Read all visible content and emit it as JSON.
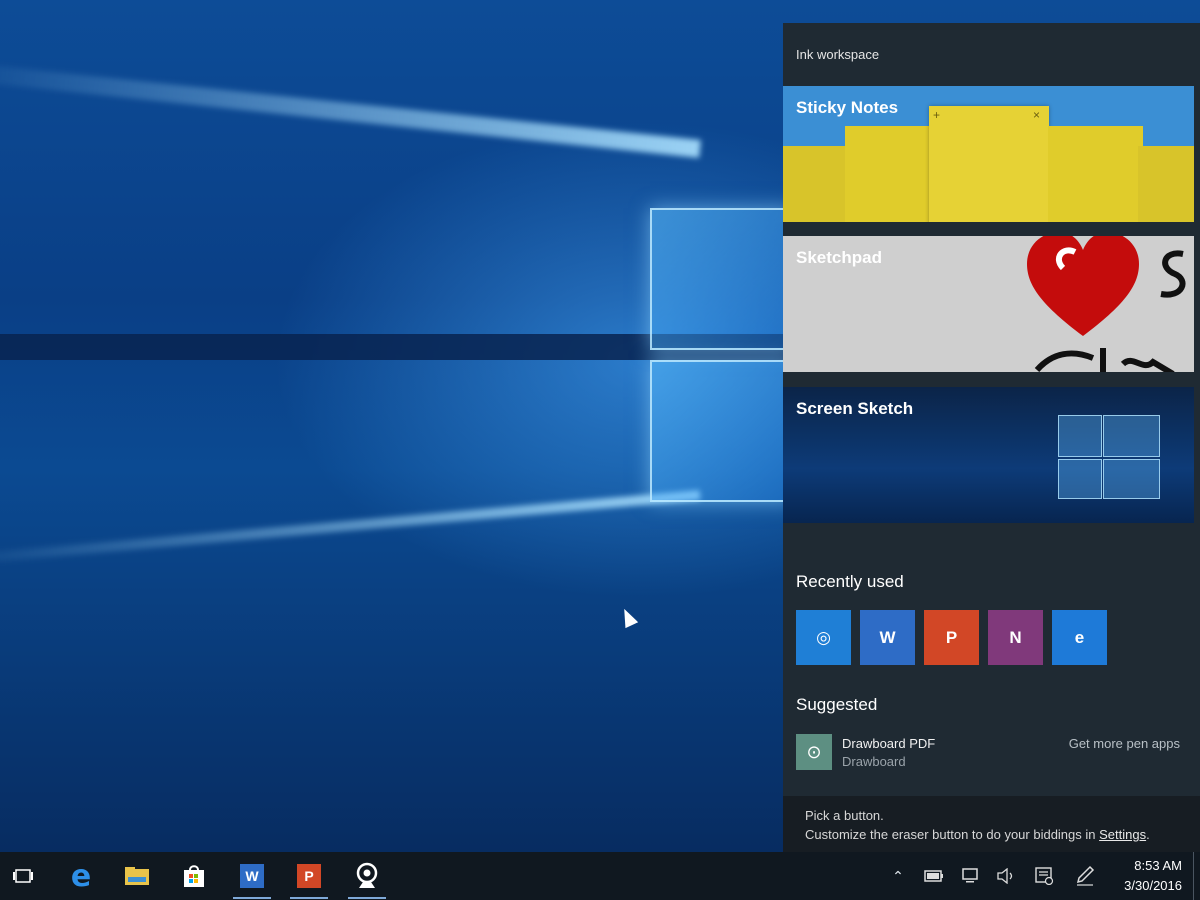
{
  "panel": {
    "title": "Ink workspace",
    "tiles": [
      {
        "label": "Sticky Notes"
      },
      {
        "label": "Sketchpad"
      },
      {
        "label": "Screen Sketch"
      }
    ],
    "recent_heading": "Recently used",
    "recent_apps": [
      {
        "name": "webcam-app-icon",
        "color": "#1f7fd6",
        "glyph": "◎"
      },
      {
        "name": "word-icon",
        "color": "#2e6cc6",
        "glyph": "W"
      },
      {
        "name": "powerpoint-icon",
        "color": "#d24726",
        "glyph": "P"
      },
      {
        "name": "onenote-icon",
        "color": "#80397b",
        "glyph": "N"
      },
      {
        "name": "edge-icon",
        "color": "#1e7ad8",
        "glyph": "e"
      }
    ],
    "suggested_heading": "Suggested",
    "suggested": {
      "name": "Drawboard PDF",
      "publisher": "Drawboard",
      "more": "Get more pen apps"
    },
    "tip": {
      "line1": "Pick a button.",
      "line2": "Customize the eraser button to do your biddings in ",
      "settings_link": "Settings",
      "end": "."
    }
  },
  "taskbar": {
    "clock_time": "8:53 AM",
    "clock_date": "3/30/2016"
  }
}
